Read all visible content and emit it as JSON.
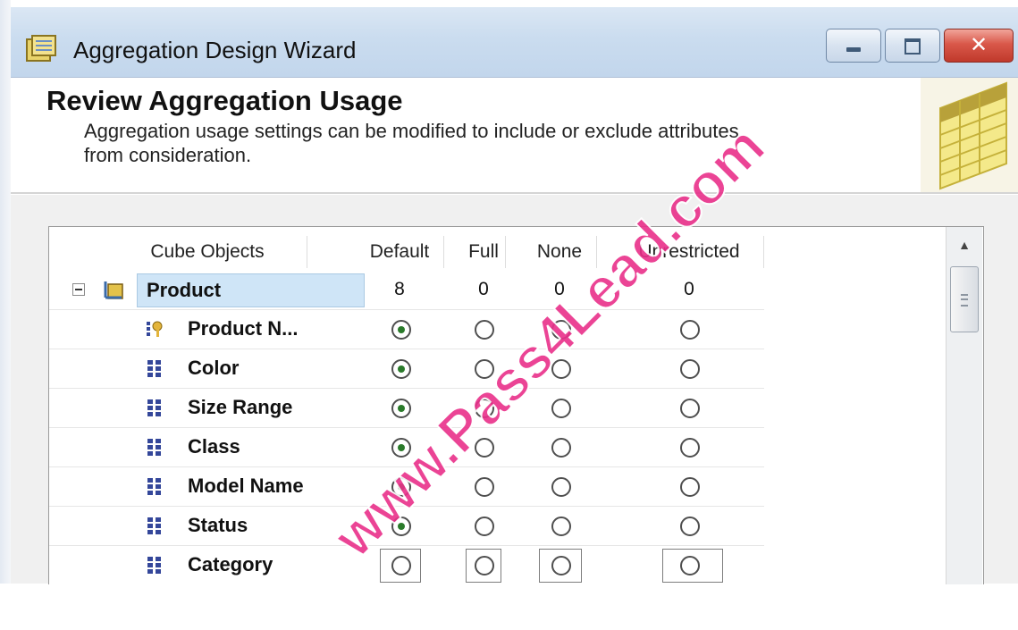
{
  "window": {
    "title": "Aggregation Design Wizard",
    "buttons": {
      "minimize": "minimize-icon",
      "maximize": "maximize-icon",
      "close": "close-icon",
      "close_glyph": "✕"
    }
  },
  "header": {
    "title": "Review Aggregation Usage",
    "description_line1": "Aggregation usage settings can be modified to include or exclude attributes",
    "description_line2": "from consideration."
  },
  "grid": {
    "columns": [
      "Cube Objects",
      "Default",
      "Full",
      "None",
      "Unrestricted"
    ],
    "dimension": {
      "name": "Product",
      "counts": {
        "default": "8",
        "full": "0",
        "none": "0",
        "unrestricted": "0"
      }
    },
    "attributes": [
      {
        "name": "Product N...",
        "icon": "key-attribute-icon",
        "selected": "Default"
      },
      {
        "name": "Color",
        "icon": "attribute-icon",
        "selected": "Default"
      },
      {
        "name": "Size Range",
        "icon": "attribute-icon",
        "selected": "Default"
      },
      {
        "name": "Class",
        "icon": "attribute-icon",
        "selected": "Default"
      },
      {
        "name": "Model Name",
        "icon": "attribute-icon",
        "selected": "Default"
      },
      {
        "name": "Status",
        "icon": "attribute-icon",
        "selected": "Default"
      },
      {
        "name": "Category",
        "icon": "attribute-icon",
        "selected": ""
      }
    ]
  },
  "watermark": {
    "text": "www.Pass4Lead.com",
    "color": "#e9308a"
  },
  "colors": {
    "title_bar": "#cadcef",
    "product_highlight": "#cfe5f7",
    "close_button": "#c0392b"
  }
}
